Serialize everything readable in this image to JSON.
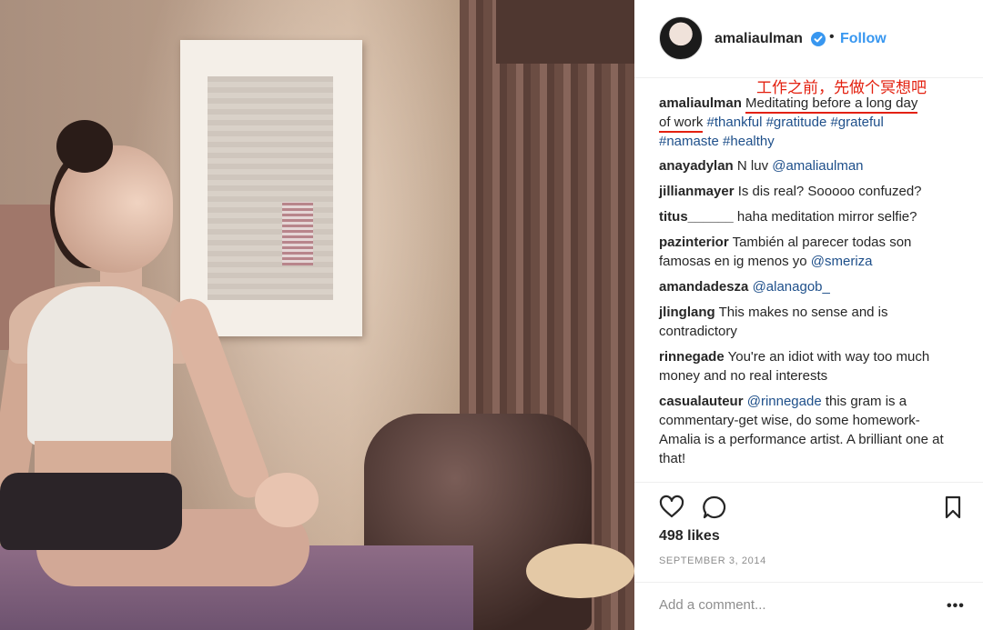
{
  "post": {
    "author": "amaliaulman",
    "follow_label": "Follow",
    "separator": "•",
    "annotation": "工作之前，先做个冥想吧",
    "caption": {
      "username": "amaliaulman",
      "text_underlined_1": "Meditating before a long day",
      "text_underlined_2": "of work",
      "hashtags_1": "#thankful #gratitude #grateful",
      "hashtags_2": "#namaste #healthy"
    },
    "comments": [
      {
        "user": "anayadylan",
        "text": "N luv ",
        "mention": "@amaliaulman",
        "text_after": ""
      },
      {
        "user": "jillianmayer",
        "text": "Is dis real? Sooooo confuzed?",
        "mention": "",
        "text_after": ""
      },
      {
        "user": "titus______",
        "text": "haha meditation mirror selfie?",
        "mention": "",
        "text_after": ""
      },
      {
        "user": "pazinterior",
        "text": "También al parecer todas son famosas en ig menos yo ",
        "mention": "@smeriza",
        "text_after": ""
      },
      {
        "user": "amandadesza",
        "text": "",
        "mention": "@alanagob_",
        "text_after": ""
      },
      {
        "user": "jlinglang",
        "text": "This makes no sense and is contradictory",
        "mention": "",
        "text_after": ""
      },
      {
        "user": "rinnegade",
        "text": "You're an idiot with way too much money and no real interests",
        "mention": "",
        "text_after": ""
      },
      {
        "user": "casualauteur",
        "text": "",
        "mention": "@rinnegade",
        "text_after": " this gram is a commentary-get wise, do some homework- Amalia is a performance artist. A brilliant one at that!"
      }
    ],
    "likes": "498 likes",
    "date": "SEPTEMBER 3, 2014",
    "add_comment_placeholder": "Add a comment...",
    "more_label": "•••"
  },
  "icons": {
    "like": "heart-icon",
    "comment": "comment-bubble-icon",
    "save": "bookmark-icon",
    "verified": "verified-badge-icon"
  },
  "colors": {
    "link_blue": "#3897f0",
    "tag_blue": "#1e4f8a",
    "annotation_red": "#e3200f"
  }
}
